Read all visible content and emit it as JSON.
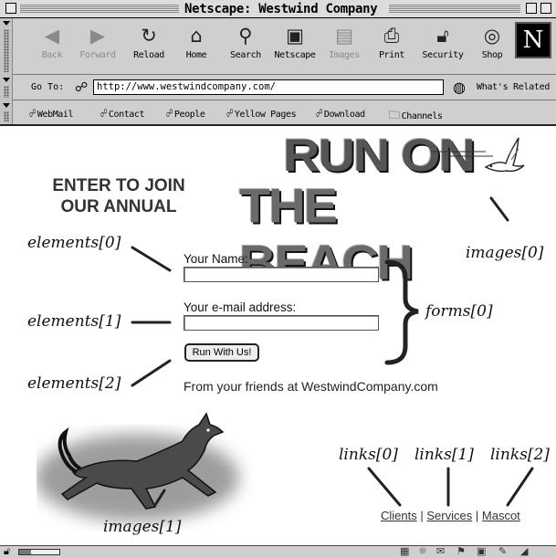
{
  "window": {
    "title": "Netscape: Westwind Company"
  },
  "toolbar": {
    "buttons": [
      {
        "label": "Back",
        "icon": "back-arrow-icon",
        "glyph": "◀",
        "enabled": false
      },
      {
        "label": "Forward",
        "icon": "forward-arrow-icon",
        "glyph": "▶",
        "enabled": false
      },
      {
        "label": "Reload",
        "icon": "reload-icon",
        "glyph": "↻",
        "enabled": true
      },
      {
        "label": "Home",
        "icon": "home-icon",
        "glyph": "⌂",
        "enabled": true
      },
      {
        "label": "Search",
        "icon": "search-icon",
        "glyph": "⚲",
        "enabled": true
      },
      {
        "label": "Netscape",
        "icon": "netscape-icon",
        "glyph": "▣",
        "enabled": true
      },
      {
        "label": "Images",
        "icon": "images-icon",
        "glyph": "▤",
        "enabled": false
      },
      {
        "label": "Print",
        "icon": "print-icon",
        "glyph": "⎙",
        "enabled": true
      },
      {
        "label": "Security",
        "icon": "padlock-icon",
        "glyph": "🔓︎",
        "enabled": true
      },
      {
        "label": "Shop",
        "icon": "shop-icon",
        "glyph": "◎",
        "enabled": true
      }
    ],
    "logo": "N"
  },
  "location": {
    "go_to_label": "Go To:",
    "url": "http://www.westwindcompany.com/",
    "whats_related": "What's Related"
  },
  "personal_toolbar": {
    "items": [
      {
        "label": "WebMail",
        "icon": "bookmark-icon"
      },
      {
        "label": "Contact",
        "icon": "bookmark-icon"
      },
      {
        "label": "People",
        "icon": "bookmark-icon"
      },
      {
        "label": "Yellow Pages",
        "icon": "bookmark-icon"
      },
      {
        "label": "Download",
        "icon": "bookmark-icon"
      },
      {
        "label": "Channels",
        "icon": "folder-icon"
      }
    ]
  },
  "page": {
    "banner_line1": "RUN ON",
    "banner_line2": "THE BEACH",
    "intro": "ENTER TO JOIN OUR ANNUAL",
    "name_label": "Your Name:",
    "name_value": "",
    "email_label": "Your e-mail address:",
    "email_value": "",
    "submit_label": "Run With Us!",
    "footer_text": "From your friends at WestwindCompany.com",
    "links": [
      "Clients",
      "Services",
      "Mascot"
    ],
    "link_separator": "|"
  },
  "annotations": {
    "elements0": "elements[0]",
    "elements1": "elements[1]",
    "elements2": "elements[2]",
    "forms0": "forms[0]",
    "images0": "images[0]",
    "images1": "images[1]",
    "links0": "links[0]",
    "links1": "links[1]",
    "links2": "links[2]"
  },
  "colors": {
    "chrome": "#cfcfcf",
    "page": "#ffffff",
    "ink": "#111111"
  },
  "status": {
    "progress": 0.3
  }
}
